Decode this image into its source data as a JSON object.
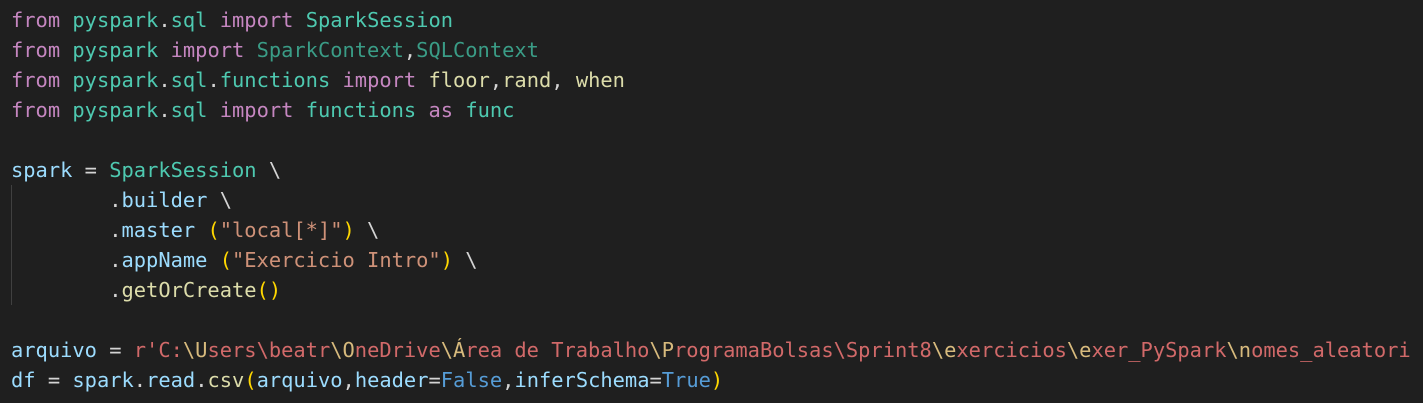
{
  "editor": {
    "lines": [
      [
        [
          "from",
          "kw"
        ],
        [
          " ",
          ""
        ],
        [
          "pyspark",
          "mod"
        ],
        [
          ".",
          ""
        ],
        [
          "sql",
          "mod"
        ],
        [
          " ",
          ""
        ],
        [
          "import",
          "kw"
        ],
        [
          " ",
          ""
        ],
        [
          "SparkSession",
          "cls"
        ]
      ],
      [
        [
          "from",
          "kw"
        ],
        [
          " ",
          ""
        ],
        [
          "pyspark",
          "mod"
        ],
        [
          " ",
          ""
        ],
        [
          "import",
          "kw"
        ],
        [
          " ",
          ""
        ],
        [
          "SparkContext",
          "cls2"
        ],
        [
          ",",
          ""
        ],
        [
          "SQLContext",
          "cls2"
        ]
      ],
      [
        [
          "from",
          "kw"
        ],
        [
          " ",
          ""
        ],
        [
          "pyspark",
          "mod"
        ],
        [
          ".",
          ""
        ],
        [
          "sql",
          "mod"
        ],
        [
          ".",
          ""
        ],
        [
          "functions",
          "mod"
        ],
        [
          " ",
          ""
        ],
        [
          "import",
          "kw"
        ],
        [
          " ",
          ""
        ],
        [
          "floor",
          "fn"
        ],
        [
          ",",
          ""
        ],
        [
          "rand",
          "fn"
        ],
        [
          ", ",
          ""
        ],
        [
          "when",
          "fn"
        ]
      ],
      [
        [
          "from",
          "kw"
        ],
        [
          " ",
          ""
        ],
        [
          "pyspark",
          "mod"
        ],
        [
          ".",
          ""
        ],
        [
          "sql",
          "mod"
        ],
        [
          " ",
          ""
        ],
        [
          "import",
          "kw"
        ],
        [
          " ",
          ""
        ],
        [
          "functions",
          "mod"
        ],
        [
          " ",
          ""
        ],
        [
          "as",
          "kw"
        ],
        [
          " ",
          ""
        ],
        [
          "func",
          "mod"
        ]
      ],
      [],
      [
        [
          "spark",
          "var"
        ],
        [
          " = ",
          ""
        ],
        [
          "SparkSession",
          "cls"
        ],
        [
          " \\",
          ""
        ]
      ],
      [
        [
          "        .",
          ""
        ],
        [
          "builder",
          "var"
        ],
        [
          " \\",
          ""
        ]
      ],
      [
        [
          "        .",
          ""
        ],
        [
          "master",
          "var"
        ],
        [
          " ",
          ""
        ],
        [
          "(",
          "br"
        ],
        [
          "\"local[*]\"",
          "str"
        ],
        [
          ")",
          "br"
        ],
        [
          " \\",
          ""
        ]
      ],
      [
        [
          "        .",
          ""
        ],
        [
          "appName",
          "var"
        ],
        [
          " ",
          ""
        ],
        [
          "(",
          "br"
        ],
        [
          "\"Exercicio Intro\"",
          "str"
        ],
        [
          ")",
          "br"
        ],
        [
          " \\",
          ""
        ]
      ],
      [
        [
          "        .",
          ""
        ],
        [
          "getOrCreate",
          "fn"
        ],
        [
          "()",
          "br"
        ]
      ],
      [],
      [
        [
          "arquivo",
          "var"
        ],
        [
          " = ",
          ""
        ],
        [
          "r'C:",
          "rstr"
        ],
        [
          "\\U",
          "esc"
        ],
        [
          "sers",
          "rstr"
        ],
        [
          "\\beatr",
          "rstr"
        ],
        [
          "\\O",
          "esc"
        ],
        [
          "neDrive",
          "rstr"
        ],
        [
          "\\Á",
          "esc"
        ],
        [
          "rea de Trabalho",
          "rstr"
        ],
        [
          "\\P",
          "esc"
        ],
        [
          "rogramaBolsas\\Sprint8",
          "rstr"
        ],
        [
          "\\e",
          "esc"
        ],
        [
          "xercicios",
          "rstr"
        ],
        [
          "\\e",
          "esc"
        ],
        [
          "xer_PySpark",
          "rstr"
        ],
        [
          "\\n",
          "esc"
        ],
        [
          "omes_aleatori",
          "rstr"
        ]
      ],
      [
        [
          "df",
          "var"
        ],
        [
          " = ",
          ""
        ],
        [
          "spark",
          "var"
        ],
        [
          ".",
          ""
        ],
        [
          "read",
          "var"
        ],
        [
          ".",
          ""
        ],
        [
          "csv",
          "fn"
        ],
        [
          "(",
          "br"
        ],
        [
          "arquivo",
          "var"
        ],
        [
          ",",
          ""
        ],
        [
          "header",
          "var"
        ],
        [
          "=",
          ""
        ],
        [
          "False",
          "const"
        ],
        [
          ",",
          ""
        ],
        [
          "inferSchema",
          "var"
        ],
        [
          "=",
          ""
        ],
        [
          "True",
          "const"
        ],
        [
          ")",
          "br"
        ]
      ]
    ]
  },
  "colors": {
    "background": "#1f1f1f",
    "keyword": "#c586c0",
    "module": "#4ec9b0",
    "string": "#ce9178",
    "regex_string": "#d16969",
    "escape": "#d7ba7d",
    "constant": "#569cd6",
    "variable": "#9cdcfe",
    "function": "#dcdcaa",
    "bracket": "#ffd700"
  }
}
